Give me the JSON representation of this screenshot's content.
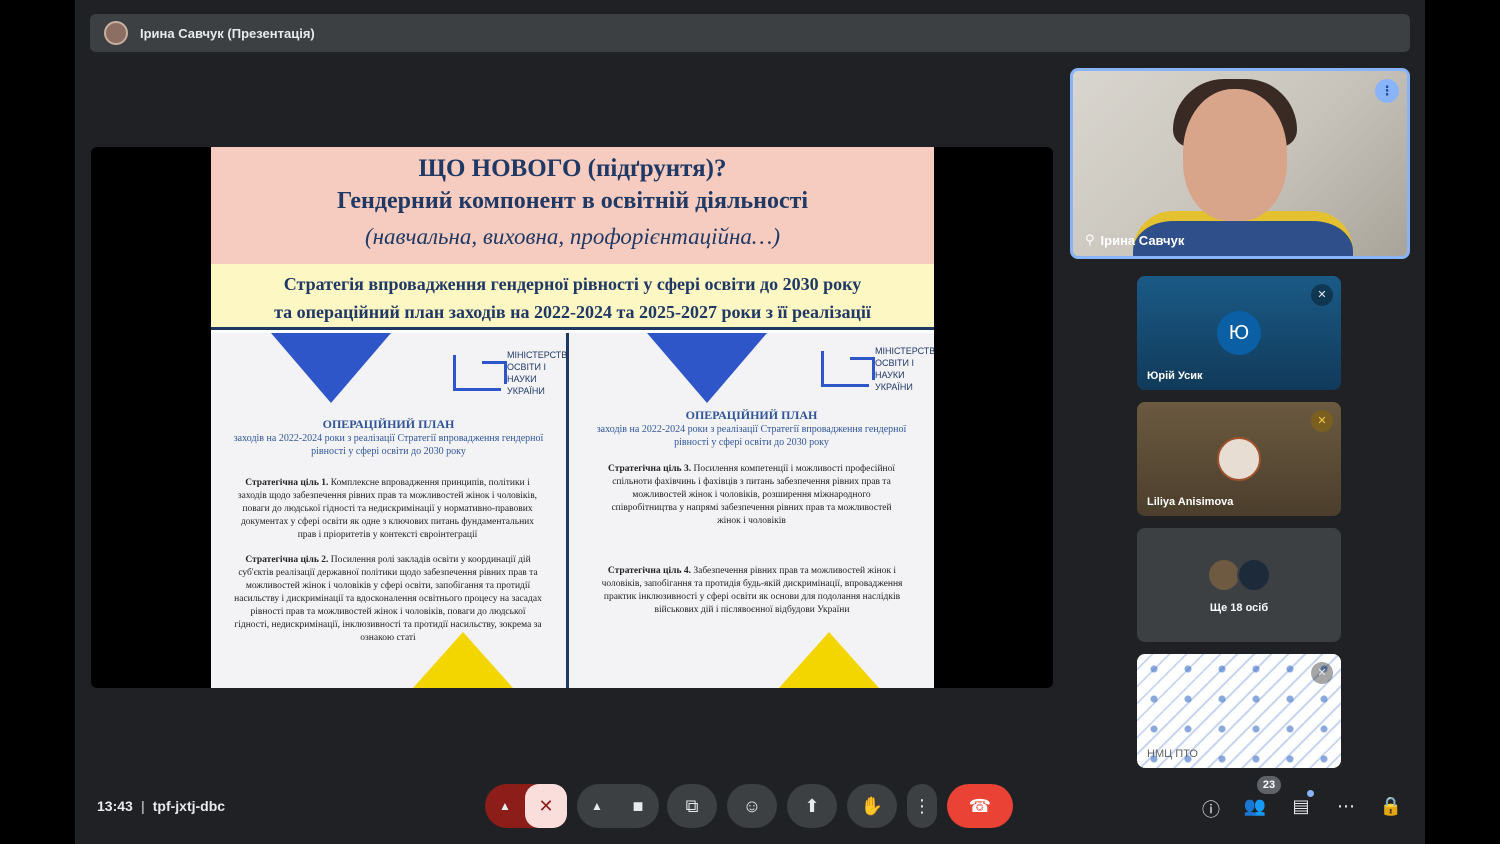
{
  "banner": {
    "text": "Ірина Савчук (Презентація)"
  },
  "slide": {
    "title1": "ЩО НОВОГО (підґрунтя)?",
    "title2": "Гендерний компонент в освітній діяльності",
    "title3": "(навчальна, виховна, профорієнтаційна…)",
    "strategy1": "Стратегія впровадження гендерної рівності у сфері освіти до 2030 року",
    "strategy2": "та операційний план заходів на 2022-2024 та 2025-2027 роки з її реалізації",
    "logo_text": "МІНІСТЕРСТВО ОСВІТИ І НАУКИ УКРАЇНИ",
    "left": {
      "plan_title": "ОПЕРАЦІЙНИЙ ПЛАН",
      "plan_sub": "заходів на 2022-2024 роки з реалізації Стратегії впровадження гендерної рівності у сфері освіти до 2030 року",
      "goal1_label": "Стратегічна ціль 1.",
      "goal1_text": " Комплексне впровадження принципів, політики і заходів щодо забезпечення рівних прав та можливостей жінок і чоловіків, поваги до людської гідності та недискримінації у нормативно-правових документах у сфері освіти як одне з ключових питань фундаментальних прав і пріоритетів у контексті євроінтеграції",
      "goal2_label": "Стратегічна ціль 2.",
      "goal2_text": " Посилення ролі закладів освіти у координації дій суб'єктів реалізації державної політики щодо забезпечення рівних прав та можливостей жінок і чоловіків у сфері освіти, запобігання та протидії насильству і дискримінації та вдосконалення освітнього процесу на засадах рівності прав та можливостей жінок і чоловіків, поваги до людської гідності, недискримінації, інклюзивності та протидії насильству, зокрема за ознакою статі"
    },
    "right": {
      "plan_title": "ОПЕРАЦІЙНИЙ ПЛАН",
      "plan_sub": "заходів на 2022-2024 роки з реалізації Стратегії впровадження гендерної рівності у сфері освіти до 2030 року",
      "goal3_label": "Стратегічна ціль 3.",
      "goal3_text": " Посилення компетенції і можливості професійної спільноти фахівчинь і фахівців з питань забезпечення рівних прав та можливостей жінок і чоловіків, розширення міжнародного співробітництва у напрямі забезпечення рівних прав та можливостей жінок і чоловіків",
      "goal4_label": "Стратегічна ціль 4.",
      "goal4_text": " Забезпечення рівних прав та можливостей жінок і чоловіків, запобігання та протидія будь-якій дискримінації, впровадження практик інклюзивності у сфері освіти як основи для подолання наслідків військових дій і післявоєнної відбудови України"
    }
  },
  "participants": {
    "self_name": "Ірина Савчук",
    "yuri_initial": "Ю",
    "yuri_name": "Юрій Усик",
    "liliya_name": "Liliya Anisimova",
    "more_label": "Ще 18 осіб",
    "nmc_name": "НМЦ ПТО"
  },
  "bottom": {
    "time": "13:43",
    "separator": "|",
    "meeting_code": "tpf-jxtj-dbc",
    "participant_count": "23"
  },
  "colors": {
    "accent": "#8ab4f8",
    "hangup": "#ea4335",
    "mic_off_bg": "#f9dedc",
    "slide_head": "#f7ccc0",
    "slide_strategy": "#fdf7c4"
  },
  "icons": {
    "chevron": "chevron-up-icon",
    "mic": "mic-off-icon",
    "camera": "camera-icon",
    "captions": "captions-icon",
    "emoji": "emoji-icon",
    "present": "present-icon",
    "hand": "raise-hand-icon",
    "more": "more-vert-icon",
    "hangup": "call-end-icon",
    "info": "info-icon",
    "people": "people-icon",
    "chat": "chat-icon",
    "activities": "apps-icon",
    "host": "host-controls-icon"
  }
}
